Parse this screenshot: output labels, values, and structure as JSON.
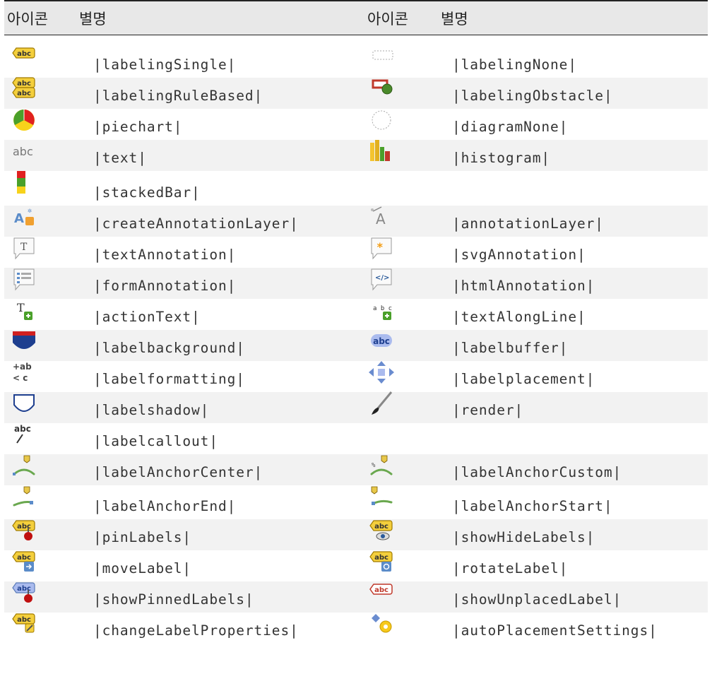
{
  "header": {
    "col1_icon": "아이콘",
    "col1_name": "별명",
    "col2_icon": "아이콘",
    "col2_name": "별명"
  },
  "rows": [
    {
      "left": {
        "icon": "labeling-single-icon",
        "label": "|labelingSingle|"
      },
      "right": {
        "icon": "labeling-none-icon",
        "label": "|labelingNone|"
      }
    },
    {
      "left": {
        "icon": "labeling-rule-based-icon",
        "label": "|labelingRuleBased|"
      },
      "right": {
        "icon": "labeling-obstacle-icon",
        "label": "|labelingObstacle|"
      }
    },
    {
      "left": {
        "icon": "piechart-icon",
        "label": "|piechart|"
      },
      "right": {
        "icon": "diagram-none-icon",
        "label": "|diagramNone|"
      }
    },
    {
      "left": {
        "icon": "text-icon",
        "label": "|text|",
        "icon_text": "abc"
      },
      "right": {
        "icon": "histogram-icon",
        "label": "|histogram|"
      }
    },
    {
      "left": {
        "icon": "stacked-bar-icon",
        "label": "|stackedBar|"
      },
      "right": null
    },
    {
      "left": {
        "icon": "create-annotation-layer-icon",
        "label": "|createAnnotationLayer|"
      },
      "right": {
        "icon": "annotation-layer-icon",
        "label": "|annotationLayer|"
      }
    },
    {
      "left": {
        "icon": "text-annotation-icon",
        "label": "|textAnnotation|"
      },
      "right": {
        "icon": "svg-annotation-icon",
        "label": "|svgAnnotation|"
      }
    },
    {
      "left": {
        "icon": "form-annotation-icon",
        "label": "|formAnnotation|"
      },
      "right": {
        "icon": "html-annotation-icon",
        "label": "|htmlAnnotation|"
      }
    },
    {
      "left": {
        "icon": "action-text-icon",
        "label": "|actionText|"
      },
      "right": {
        "icon": "text-along-line-icon",
        "label": "|textAlongLine|"
      }
    },
    {
      "left": {
        "icon": "label-background-icon",
        "label": "|labelbackground|"
      },
      "right": {
        "icon": "label-buffer-icon",
        "label": "|labelbuffer|",
        "icon_text": "abc"
      }
    },
    {
      "left": {
        "icon": "label-formatting-icon",
        "label": "|labelformatting|"
      },
      "right": {
        "icon": "label-placement-icon",
        "label": "|labelplacement|"
      }
    },
    {
      "left": {
        "icon": "label-shadow-icon",
        "label": "|labelshadow|"
      },
      "right": {
        "icon": "render-icon",
        "label": "|render|"
      }
    },
    {
      "left": {
        "icon": "label-callout-icon",
        "label": "|labelcallout|",
        "icon_text": "abc"
      },
      "right": null
    },
    {
      "left": {
        "icon": "label-anchor-center-icon",
        "label": "|labelAnchorCenter|"
      },
      "right": {
        "icon": "label-anchor-custom-icon",
        "label": "|labelAnchorCustom|"
      }
    },
    {
      "left": {
        "icon": "label-anchor-end-icon",
        "label": "|labelAnchorEnd|"
      },
      "right": {
        "icon": "label-anchor-start-icon",
        "label": "|labelAnchorStart|"
      }
    },
    {
      "left": {
        "icon": "pin-labels-icon",
        "label": "|pinLabels|"
      },
      "right": {
        "icon": "show-hide-labels-icon",
        "label": "|showHideLabels|"
      }
    },
    {
      "left": {
        "icon": "move-label-icon",
        "label": "|moveLabel|"
      },
      "right": {
        "icon": "rotate-label-icon",
        "label": "|rotateLabel|"
      }
    },
    {
      "left": {
        "icon": "show-pinned-labels-icon",
        "label": "|showPinnedLabels|"
      },
      "right": {
        "icon": "show-unplaced-label-icon",
        "label": "|showUnplacedLabel|",
        "icon_text": "abc"
      }
    },
    {
      "left": {
        "icon": "change-label-properties-icon",
        "label": "|changeLabelProperties|"
      },
      "right": {
        "icon": "auto-placement-settings-icon",
        "label": "|autoPlacementSettings|"
      }
    }
  ]
}
